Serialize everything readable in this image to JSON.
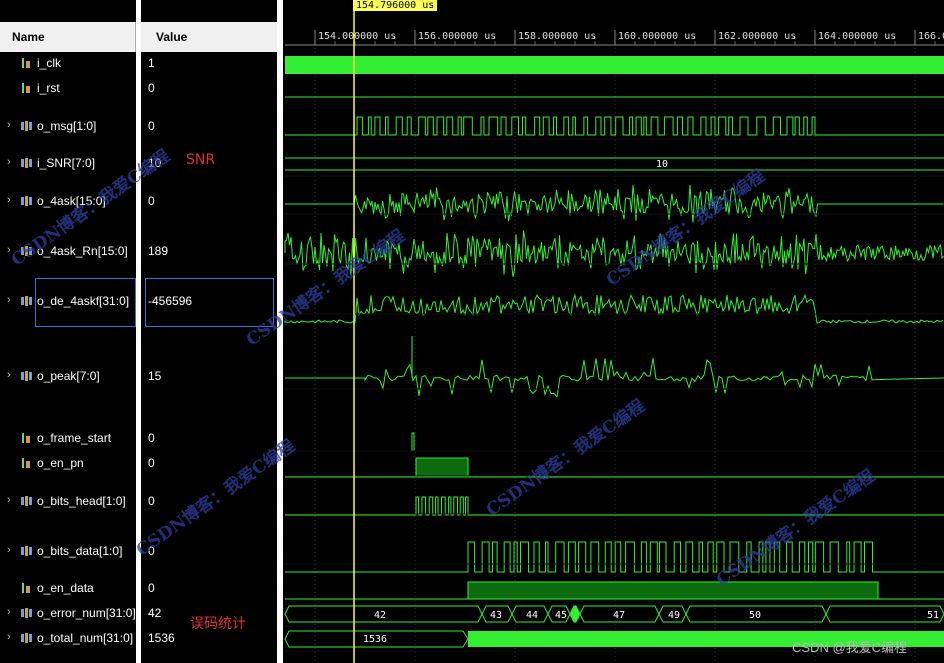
{
  "header": {
    "name": "Name",
    "value": "Value"
  },
  "cursor": {
    "time": "154.796000 us"
  },
  "time_axis": {
    "ticks": [
      "154.000000 us",
      "156.000000 us",
      "158.000000 us",
      "160.000000 us",
      "162.000000 us",
      "164.000000 us",
      "166.0"
    ]
  },
  "signals": [
    {
      "name": "i_clk",
      "value": "1",
      "icon": "bit-icon",
      "expandable": false
    },
    {
      "name": "i_rst",
      "value": "0",
      "icon": "bit-icon",
      "expandable": false
    },
    {
      "name": "o_msg[1:0]",
      "value": "0",
      "icon": "bus-icon",
      "expandable": true
    },
    {
      "name": "i_SNR[7:0]",
      "value": "10",
      "icon": "bus-icon",
      "expandable": true
    },
    {
      "name": "o_4ask[15:0]",
      "value": "0",
      "icon": "bus-icon",
      "expandable": true
    },
    {
      "name": "o_4ask_Rn[15:0]",
      "value": "189",
      "icon": "bus-icon",
      "expandable": true
    },
    {
      "name": "o_de_4askf[31:0]",
      "value": "-456596",
      "icon": "bus-icon",
      "expandable": true
    },
    {
      "name": "o_peak[7:0]",
      "value": "15",
      "icon": "bus-icon",
      "expandable": true
    },
    {
      "name": "o_frame_start",
      "value": "0",
      "icon": "bit-icon",
      "expandable": false
    },
    {
      "name": "o_en_pn",
      "value": "0",
      "icon": "bit-icon",
      "expandable": false
    },
    {
      "name": "o_bits_head[1:0]",
      "value": "0",
      "icon": "bus-icon",
      "expandable": true
    },
    {
      "name": "o_bits_data[1:0]",
      "value": "0",
      "icon": "bus-icon",
      "expandable": true
    },
    {
      "name": "o_en_data",
      "value": "0",
      "icon": "bit-icon",
      "expandable": false
    },
    {
      "name": "o_error_num[31:0]",
      "value": "42",
      "icon": "bus-icon",
      "expandable": true
    },
    {
      "name": "o_total_num[31:0]",
      "value": "1536",
      "icon": "bus-icon",
      "expandable": true
    }
  ],
  "waveform_labels": {
    "snr_bus": "10",
    "error_values": [
      "42",
      "43",
      "44",
      "45",
      "47",
      "49",
      "50",
      "51"
    ],
    "total_values": [
      "1536"
    ]
  },
  "annotations": {
    "snr": "SNR",
    "error_stats": "误码统计"
  },
  "watermark": "CSDN博客：我爱C编程",
  "footer": "CSDN @我爱C编程",
  "colors": {
    "wave": "#33ee33",
    "cursor": "#ffff33",
    "annotation": "#e03030",
    "watermark": "#2e3fa0",
    "selection": "#3b6fd6"
  }
}
